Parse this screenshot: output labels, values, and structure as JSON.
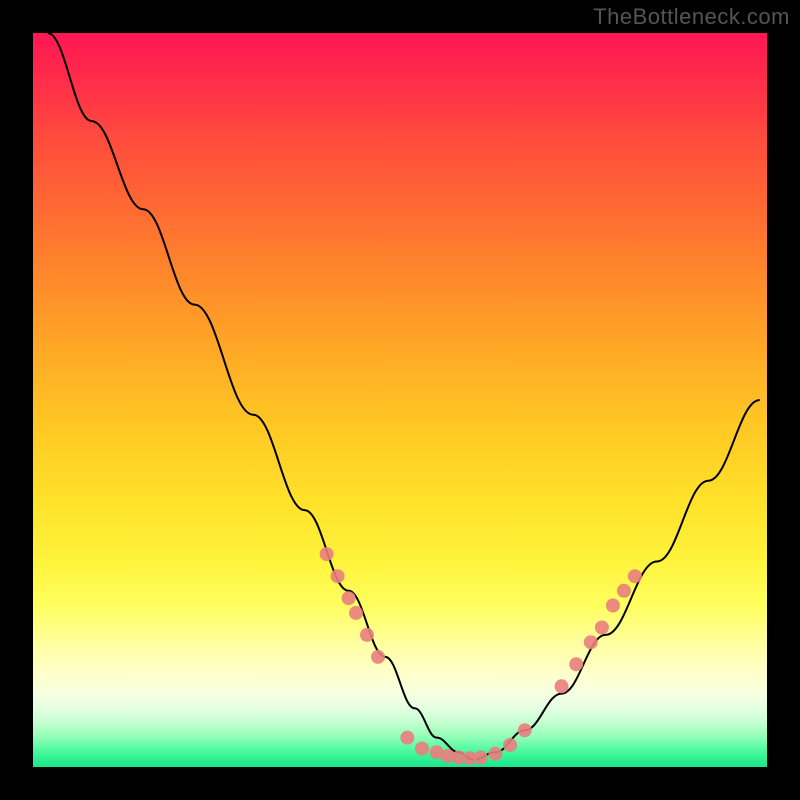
{
  "watermark": "TheBottleneck.com",
  "chart_data": {
    "type": "line",
    "title": "",
    "xlabel": "",
    "ylabel": "",
    "xlim": [
      0,
      100
    ],
    "ylim": [
      0,
      100
    ],
    "grid": false,
    "legend": false,
    "gradient_stops": [
      {
        "pos": 0,
        "color": "#ff1753"
      },
      {
        "pos": 14,
        "color": "#ff4a3e"
      },
      {
        "pos": 34,
        "color": "#ff8b2a"
      },
      {
        "pos": 54,
        "color": "#ffc924"
      },
      {
        "pos": 72,
        "color": "#fff33c"
      },
      {
        "pos": 87,
        "color": "#feffc8"
      },
      {
        "pos": 94,
        "color": "#c3ffd0"
      },
      {
        "pos": 100,
        "color": "#17e789"
      }
    ],
    "series": [
      {
        "name": "bottleneck-curve",
        "color": "#000000",
        "x": [
          2,
          8,
          15,
          22,
          30,
          37,
          43,
          48,
          52,
          55,
          58,
          60,
          63,
          67,
          72,
          78,
          85,
          92,
          99
        ],
        "y": [
          100,
          88,
          76,
          63,
          48,
          35,
          24,
          15,
          8,
          4,
          2,
          1,
          2,
          5,
          10,
          18,
          28,
          39,
          50
        ]
      }
    ],
    "marker_clusters": [
      {
        "name": "left-marker-band",
        "color": "#e97e7e",
        "x": [
          40,
          41.5,
          43,
          44,
          45.5,
          47
        ],
        "y": [
          29,
          26,
          23,
          21,
          18,
          15
        ]
      },
      {
        "name": "valley-markers",
        "color": "#e97e7e",
        "x": [
          51,
          53,
          55,
          56.5,
          58,
          59.5,
          61,
          63,
          65,
          67
        ],
        "y": [
          4,
          2.5,
          2,
          1.5,
          1.3,
          1.2,
          1.3,
          1.8,
          3,
          5
        ]
      },
      {
        "name": "right-marker-band",
        "color": "#e97e7e",
        "x": [
          72,
          74,
          76,
          77.5,
          79,
          80.5,
          82
        ],
        "y": [
          11,
          14,
          17,
          19,
          22,
          24,
          26
        ]
      }
    ]
  }
}
